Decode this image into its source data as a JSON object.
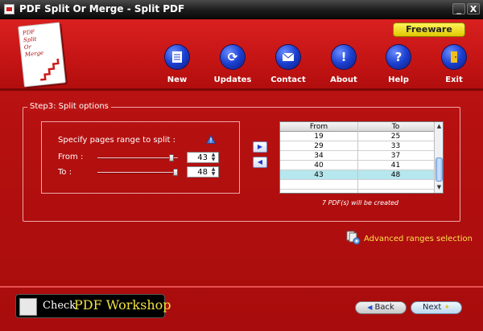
{
  "window": {
    "title": "PDF Split Or Merge - Split PDF",
    "minimize": "_",
    "close": "X"
  },
  "logo": {
    "text_lines": "PDF\nSplit\nOr\nMerge"
  },
  "header": {
    "freeware_badge": "Freeware",
    "nav": [
      {
        "label": "New",
        "icon": "document-icon"
      },
      {
        "label": "Updates",
        "icon": "refresh-icon"
      },
      {
        "label": "Contact",
        "icon": "envelope-icon"
      },
      {
        "label": "About",
        "icon": "info-icon"
      },
      {
        "label": "Help",
        "icon": "question-icon"
      },
      {
        "label": "Exit",
        "icon": "exit-door-icon"
      }
    ]
  },
  "step": {
    "legend": "Step3: Split options",
    "range_title": "Specify pages range to split :",
    "from_label": "From :",
    "to_label": "To     :",
    "from_value": "43",
    "to_value": "48",
    "from_slider_level": 0.95,
    "to_slider_level": 1.0
  },
  "table": {
    "headers": [
      "From",
      "To"
    ],
    "rows": [
      {
        "from": "19",
        "to": "25"
      },
      {
        "from": "29",
        "to": "33"
      },
      {
        "from": "34",
        "to": "37"
      },
      {
        "from": "40",
        "to": "41"
      },
      {
        "from": "43",
        "to": "48"
      }
    ],
    "selected_index": 4
  },
  "pdf_count_text": "7 PDF(s) will be created",
  "advanced_link": "Advanced ranges selection",
  "footer": {
    "check_label": "Check",
    "workshop_label": "PDF Workshop",
    "back_label": "Back",
    "next_label": "Next"
  },
  "colors": {
    "background_red": "#b51010",
    "link_yellow": "#ffe14a",
    "selected_row": "#b6e6ee"
  }
}
